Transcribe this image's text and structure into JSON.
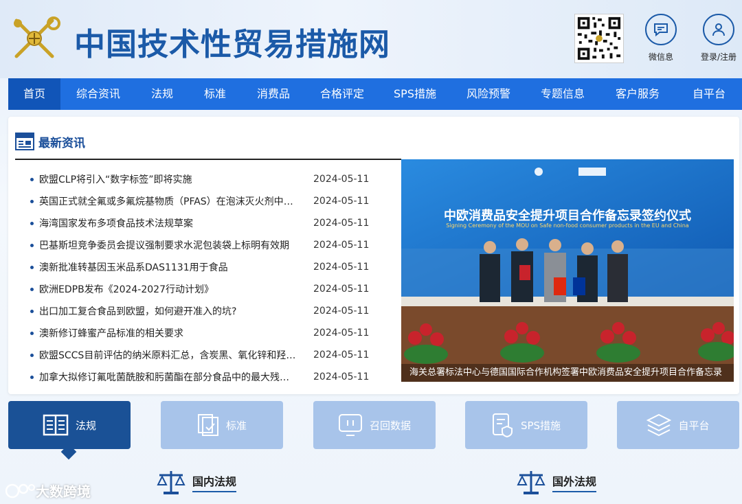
{
  "header": {
    "site_title": "中国技术性贸易措施网",
    "weixin_label": "微信息",
    "login_label": "登录/注册"
  },
  "nav": {
    "items": [
      {
        "label": "首页",
        "active": true
      },
      {
        "label": "综合资讯"
      },
      {
        "label": "法规"
      },
      {
        "label": "标准"
      },
      {
        "label": "消费品"
      },
      {
        "label": "合格评定"
      },
      {
        "label": "SPS措施"
      },
      {
        "label": "风险预警"
      },
      {
        "label": "专题信息"
      },
      {
        "label": "客户服务"
      },
      {
        "label": "自平台"
      }
    ]
  },
  "news": {
    "title": "最新资讯",
    "items": [
      {
        "title": "欧盟CLP将引入“数字标签”即将实施",
        "date": "2024-05-11"
      },
      {
        "title": "英国正式就全氟或多氟烷基物质（PFAS）在泡沫灭火剂中的限制开展咨询",
        "date": "2024-05-11"
      },
      {
        "title": "海湾国家发布多项食品技术法规草案",
        "date": "2024-05-11"
      },
      {
        "title": "巴基斯坦竞争委员会提议强制要求水泥包装袋上标明有效期",
        "date": "2024-05-11"
      },
      {
        "title": "澳新批准转基因玉米品系DAS1131用于食品",
        "date": "2024-05-11"
      },
      {
        "title": "欧洲EDPB发布《2024-2027行动计划》",
        "date": "2024-05-11"
      },
      {
        "title": "出口加工复合食品到欧盟，如何避开准入的坑?",
        "date": "2024-05-11"
      },
      {
        "title": "澳新修订蜂蜜产品标准的相关要求",
        "date": "2024-05-11"
      },
      {
        "title": "欧盟SCCS目前评估的纳米原料汇总，含炭黑、氧化锌和羟基磷灰石等",
        "date": "2024-05-11"
      },
      {
        "title": "加拿大拟修订氟吡菌酰胺和肟菌酯在部分食品中的最大残留限量",
        "date": "2024-05-11"
      }
    ]
  },
  "photo": {
    "banner_cn": "中欧消费品安全提升项目合作备忘录签约仪式",
    "banner_en": "Signing Ceremony of the MOU on Safe non-food consumer products in the EU and China",
    "caption": "海关总署标法中心与德国国际合作机构签署中欧消费品安全提升项目合作备忘录"
  },
  "quick_nav": [
    {
      "label": "法规",
      "active": true
    },
    {
      "label": "标准"
    },
    {
      "label": "召回数据"
    },
    {
      "label": "SPS措施"
    },
    {
      "label": "自平台"
    }
  ],
  "sections": {
    "domestic": "国内法规",
    "foreign": "国外法规"
  },
  "watermark": "大数跨境",
  "colors": {
    "nav_bg": "#1f6fe0",
    "nav_active": "#1155b8",
    "title_blue": "#1b5aa8",
    "quick_active": "#1a5196",
    "quick_inactive": "#a8c4ea"
  }
}
